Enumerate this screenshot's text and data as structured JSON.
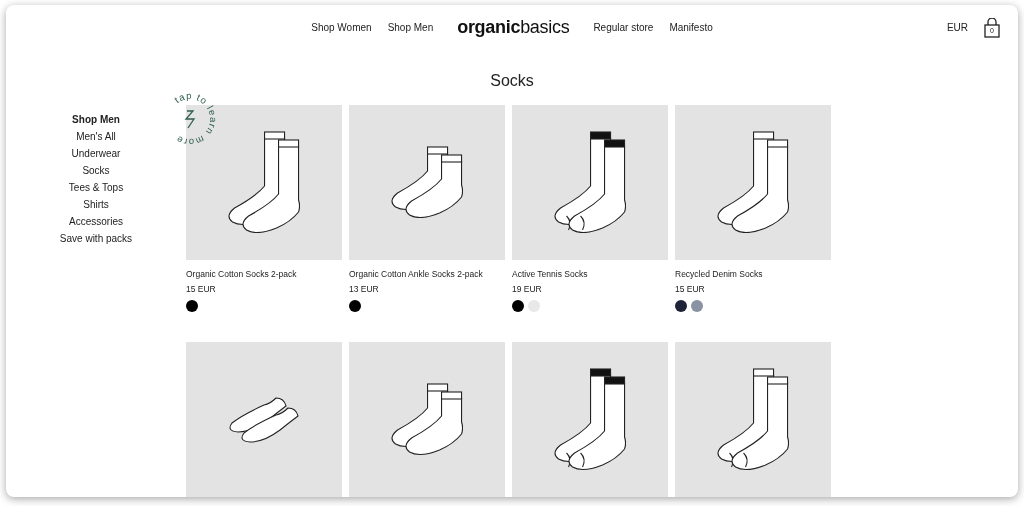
{
  "nav": {
    "links_left": [
      "Shop Women",
      "Shop Men"
    ],
    "logo_bold": "organic",
    "logo_light": "basics",
    "links_right": [
      "Regular store",
      "Manifesto"
    ],
    "currency": "EUR",
    "cart_count": "0"
  },
  "page_title": "Socks",
  "sidebar": {
    "items": [
      {
        "label": "Shop Men",
        "selected": true
      },
      {
        "label": "Men's All",
        "selected": false
      },
      {
        "label": "Underwear",
        "selected": false
      },
      {
        "label": "Socks",
        "selected": false
      },
      {
        "label": "Tees & Tops",
        "selected": false
      },
      {
        "label": "Shirts",
        "selected": false
      },
      {
        "label": "Accessories",
        "selected": false
      },
      {
        "label": "Save with packs",
        "selected": false
      }
    ]
  },
  "badge": {
    "text": "tap to learn more"
  },
  "products": [
    {
      "kind": "crew",
      "name": "Organic Cotton Socks 2-pack",
      "price": "15 EUR",
      "colors": [
        {
          "color": "#000000"
        }
      ]
    },
    {
      "kind": "ankle",
      "name": "Organic Cotton Ankle Socks 2-pack",
      "price": "13 EUR",
      "colors": [
        {
          "color": "#000000"
        }
      ]
    },
    {
      "kind": "tennis",
      "name": "Active Tennis Socks",
      "price": "19 EUR",
      "colors": [
        {
          "color": "#000000"
        },
        {
          "color": "#e8e8e8"
        }
      ]
    },
    {
      "kind": "crew",
      "name": "Recycled Denim Socks",
      "price": "15 EUR",
      "colors": [
        {
          "color": "#1e2338"
        },
        {
          "color": "#8a93a3"
        }
      ]
    },
    {
      "kind": "no-show"
    },
    {
      "kind": "ankle"
    },
    {
      "kind": "tennis"
    },
    {
      "kind": "plain"
    }
  ]
}
